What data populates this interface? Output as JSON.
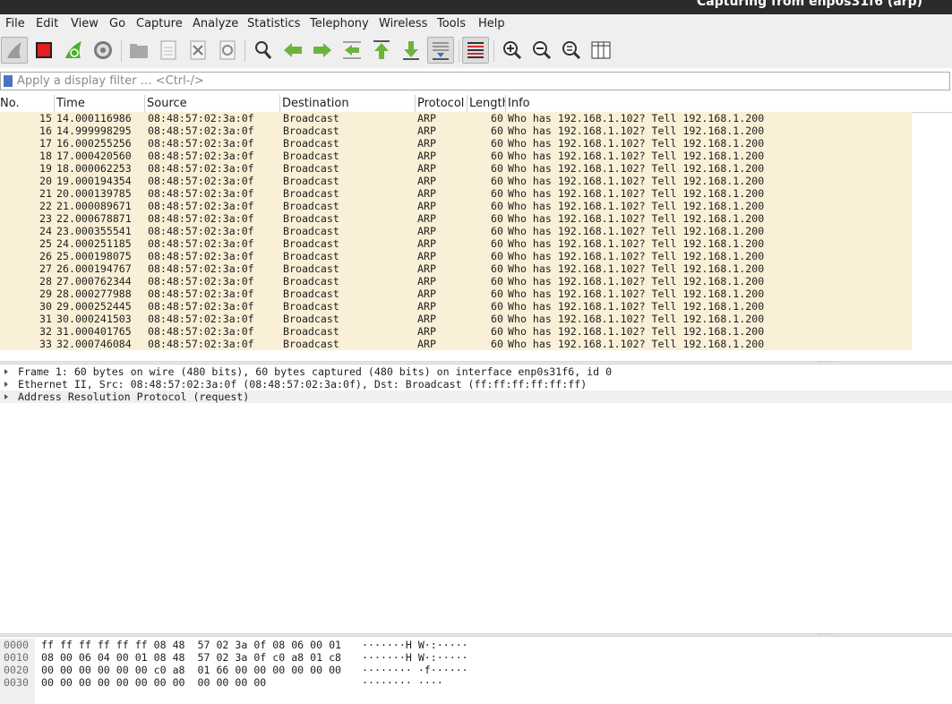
{
  "window": {
    "title": "Capturing from enp0s31f6 (arp)"
  },
  "menu": [
    "File",
    "Edit",
    "View",
    "Go",
    "Capture",
    "Analyze",
    "Statistics",
    "Telephony",
    "Wireless",
    "Tools",
    "Help"
  ],
  "toolbar": {
    "buttons": [
      "shark-fin-start-icon",
      "stop-capture-icon",
      "restart-capture-icon",
      "capture-options-icon",
      "open-file-icon",
      "save-file-icon",
      "close-file-icon",
      "reload-file-icon",
      "find-packet-icon",
      "go-back-icon",
      "go-forward-icon",
      "go-to-packet-icon",
      "go-first-packet-icon",
      "go-last-packet-icon",
      "autoscroll-icon",
      "colorize-icon",
      "zoom-in-icon",
      "zoom-out-icon",
      "normal-size-icon",
      "resize-columns-icon"
    ],
    "accent": "#4caf2a",
    "stop_color": "#e02020"
  },
  "filter": {
    "placeholder": "Apply a display filter … <Ctrl-/>"
  },
  "packet_list": {
    "columns": [
      "No.",
      "Time",
      "Source",
      "Destination",
      "Protocol",
      "Length",
      "Info"
    ],
    "row_color": "#faf0d7",
    "rows": [
      {
        "no": "15",
        "time": "14.000116986",
        "src": "08:48:57:02:3a:0f",
        "dst": "Broadcast",
        "proto": "ARP",
        "len": "60",
        "info": "Who has 192.168.1.102? Tell 192.168.1.200"
      },
      {
        "no": "16",
        "time": "14.999998295",
        "src": "08:48:57:02:3a:0f",
        "dst": "Broadcast",
        "proto": "ARP",
        "len": "60",
        "info": "Who has 192.168.1.102? Tell 192.168.1.200"
      },
      {
        "no": "17",
        "time": "16.000255256",
        "src": "08:48:57:02:3a:0f",
        "dst": "Broadcast",
        "proto": "ARP",
        "len": "60",
        "info": "Who has 192.168.1.102? Tell 192.168.1.200"
      },
      {
        "no": "18",
        "time": "17.000420560",
        "src": "08:48:57:02:3a:0f",
        "dst": "Broadcast",
        "proto": "ARP",
        "len": "60",
        "info": "Who has 192.168.1.102? Tell 192.168.1.200"
      },
      {
        "no": "19",
        "time": "18.000062253",
        "src": "08:48:57:02:3a:0f",
        "dst": "Broadcast",
        "proto": "ARP",
        "len": "60",
        "info": "Who has 192.168.1.102? Tell 192.168.1.200"
      },
      {
        "no": "20",
        "time": "19.000194354",
        "src": "08:48:57:02:3a:0f",
        "dst": "Broadcast",
        "proto": "ARP",
        "len": "60",
        "info": "Who has 192.168.1.102? Tell 192.168.1.200"
      },
      {
        "no": "21",
        "time": "20.000139785",
        "src": "08:48:57:02:3a:0f",
        "dst": "Broadcast",
        "proto": "ARP",
        "len": "60",
        "info": "Who has 192.168.1.102? Tell 192.168.1.200"
      },
      {
        "no": "22",
        "time": "21.000089671",
        "src": "08:48:57:02:3a:0f",
        "dst": "Broadcast",
        "proto": "ARP",
        "len": "60",
        "info": "Who has 192.168.1.102? Tell 192.168.1.200"
      },
      {
        "no": "23",
        "time": "22.000678871",
        "src": "08:48:57:02:3a:0f",
        "dst": "Broadcast",
        "proto": "ARP",
        "len": "60",
        "info": "Who has 192.168.1.102? Tell 192.168.1.200"
      },
      {
        "no": "24",
        "time": "23.000355541",
        "src": "08:48:57:02:3a:0f",
        "dst": "Broadcast",
        "proto": "ARP",
        "len": "60",
        "info": "Who has 192.168.1.102? Tell 192.168.1.200"
      },
      {
        "no": "25",
        "time": "24.000251185",
        "src": "08:48:57:02:3a:0f",
        "dst": "Broadcast",
        "proto": "ARP",
        "len": "60",
        "info": "Who has 192.168.1.102? Tell 192.168.1.200"
      },
      {
        "no": "26",
        "time": "25.000198075",
        "src": "08:48:57:02:3a:0f",
        "dst": "Broadcast",
        "proto": "ARP",
        "len": "60",
        "info": "Who has 192.168.1.102? Tell 192.168.1.200"
      },
      {
        "no": "27",
        "time": "26.000194767",
        "src": "08:48:57:02:3a:0f",
        "dst": "Broadcast",
        "proto": "ARP",
        "len": "60",
        "info": "Who has 192.168.1.102? Tell 192.168.1.200"
      },
      {
        "no": "28",
        "time": "27.000762344",
        "src": "08:48:57:02:3a:0f",
        "dst": "Broadcast",
        "proto": "ARP",
        "len": "60",
        "info": "Who has 192.168.1.102? Tell 192.168.1.200"
      },
      {
        "no": "29",
        "time": "28.000277988",
        "src": "08:48:57:02:3a:0f",
        "dst": "Broadcast",
        "proto": "ARP",
        "len": "60",
        "info": "Who has 192.168.1.102? Tell 192.168.1.200"
      },
      {
        "no": "30",
        "time": "29.000252445",
        "src": "08:48:57:02:3a:0f",
        "dst": "Broadcast",
        "proto": "ARP",
        "len": "60",
        "info": "Who has 192.168.1.102? Tell 192.168.1.200"
      },
      {
        "no": "31",
        "time": "30.000241503",
        "src": "08:48:57:02:3a:0f",
        "dst": "Broadcast",
        "proto": "ARP",
        "len": "60",
        "info": "Who has 192.168.1.102? Tell 192.168.1.200"
      },
      {
        "no": "32",
        "time": "31.000401765",
        "src": "08:48:57:02:3a:0f",
        "dst": "Broadcast",
        "proto": "ARP",
        "len": "60",
        "info": "Who has 192.168.1.102? Tell 192.168.1.200"
      },
      {
        "no": "33",
        "time": "32.000746084",
        "src": "08:48:57:02:3a:0f",
        "dst": "Broadcast",
        "proto": "ARP",
        "len": "60",
        "info": "Who has 192.168.1.102? Tell 192.168.1.200"
      }
    ]
  },
  "details": [
    "Frame 1: 60 bytes on wire (480 bits), 60 bytes captured (480 bits) on interface enp0s31f6, id 0",
    "Ethernet II, Src: 08:48:57:02:3a:0f (08:48:57:02:3a:0f), Dst: Broadcast (ff:ff:ff:ff:ff:ff)",
    "Address Resolution Protocol (request)"
  ],
  "bytes": [
    {
      "offset": "0000",
      "hex": "ff ff ff ff ff ff 08 48  57 02 3a 0f 08 06 00 01",
      "ascii": "·······H W·:·····"
    },
    {
      "offset": "0010",
      "hex": "08 00 06 04 00 01 08 48  57 02 3a 0f c0 a8 01 c8",
      "ascii": "·······H W·:·····"
    },
    {
      "offset": "0020",
      "hex": "00 00 00 00 00 00 c0 a8  01 66 00 00 00 00 00 00",
      "ascii": "········ ·f······"
    },
    {
      "offset": "0030",
      "hex": "00 00 00 00 00 00 00 00  00 00 00 00",
      "ascii": "········ ····"
    }
  ]
}
